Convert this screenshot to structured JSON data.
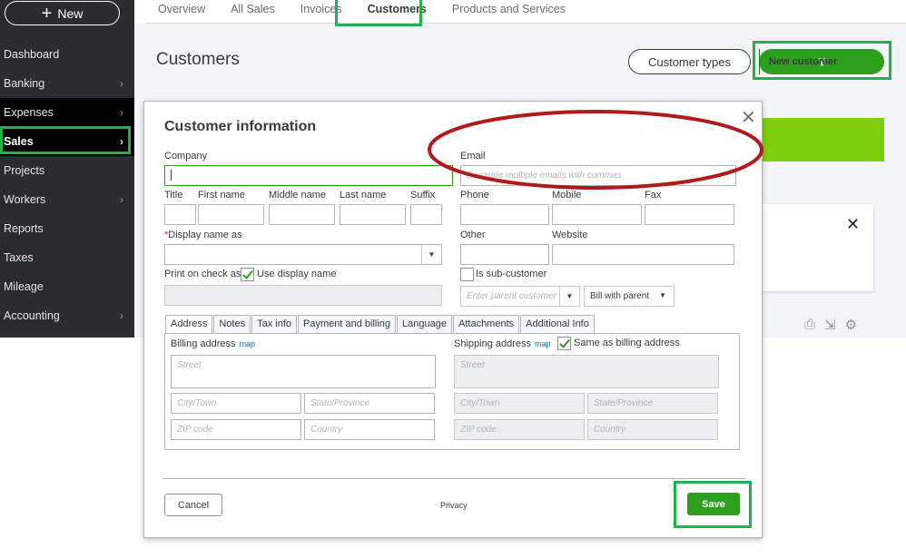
{
  "sidebar": {
    "new_label": "New",
    "items": [
      {
        "label": "Dashboard",
        "chevron": false
      },
      {
        "label": "Banking",
        "chevron": true
      },
      {
        "label": "Expenses",
        "chevron": true
      },
      {
        "label": "Sales",
        "chevron": true
      },
      {
        "label": "Projects",
        "chevron": false
      },
      {
        "label": "Workers",
        "chevron": true
      },
      {
        "label": "Reports",
        "chevron": false
      },
      {
        "label": "Taxes",
        "chevron": false
      },
      {
        "label": "Mileage",
        "chevron": false
      },
      {
        "label": "Accounting",
        "chevron": true
      }
    ]
  },
  "topnav": {
    "tabs": [
      "Overview",
      "All Sales",
      "Invoices",
      "Customers",
      "Products and Services"
    ],
    "active": "Customers"
  },
  "page": {
    "title": "Customers",
    "customer_types_label": "Customer types",
    "new_customer_label": "New customer"
  },
  "dialog": {
    "title": "Customer information",
    "company_label": "Company",
    "email_label": "Email",
    "email_placeholder": "Separate multiple emails with commas",
    "title_label": "Title",
    "first_name_label": "First name",
    "middle_name_label": "Middle name",
    "last_name_label": "Last name",
    "suffix_label": "Suffix",
    "phone_label": "Phone",
    "mobile_label": "Mobile",
    "fax_label": "Fax",
    "display_name_label": "Display name as",
    "other_label": "Other",
    "website_label": "Website",
    "print_on_check_label": "Print on check as",
    "use_display_name_label": "Use display name",
    "use_display_name_checked": true,
    "sub_customer_label": "Is sub-customer",
    "sub_customer_checked": false,
    "parent_customer_placeholder": "Enter parent customer",
    "bill_with_parent_label": "Bill with parent",
    "tabs": [
      "Address",
      "Notes",
      "Tax info",
      "Payment and billing",
      "Language",
      "Attachments",
      "Additional Info"
    ],
    "active_tab": "Address",
    "billing_address_label": "Billing address",
    "shipping_address_label": "Shipping address",
    "map_label": "map",
    "same_as_billing_label": "Same as billing address",
    "same_as_billing_checked": true,
    "street_placeholder": "Street",
    "city_placeholder": "City/Town",
    "state_placeholder": "State/Province",
    "zip_placeholder": "ZIP code",
    "country_placeholder": "Country",
    "cancel_label": "Cancel",
    "privacy_label": "Privacy",
    "save_label": "Save"
  },
  "colors": {
    "brand_green": "#2ca01c",
    "highlight_green": "#21b24b",
    "annotation_red": "#b01a1a",
    "sidebar_bg": "#2b2c30"
  }
}
